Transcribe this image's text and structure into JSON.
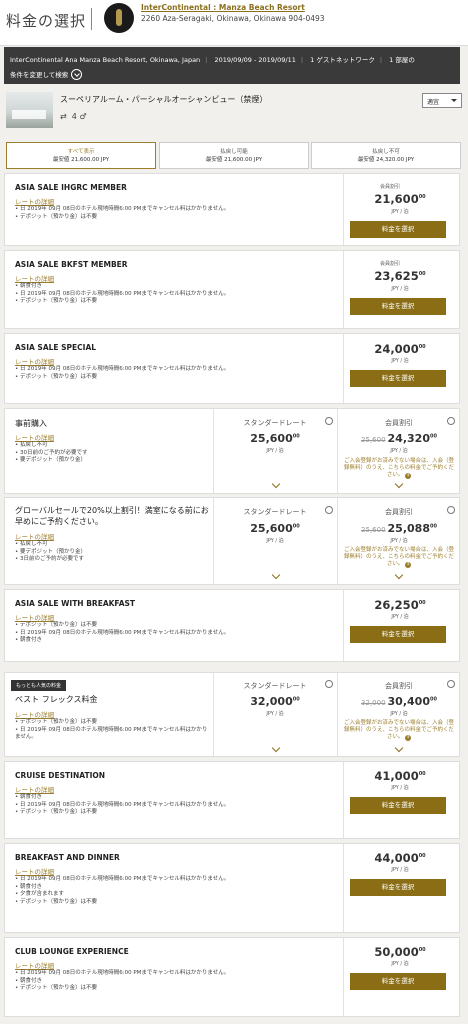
{
  "header": {
    "title": "料金の選択",
    "hotel_name": "InterContinental : Manza Beach Resort",
    "hotel_address": "2260 Aza-Seragaki, Okinawa, Okinawa 904-0493"
  },
  "search_bar": {
    "hotel": "InterContinental Ana Manza Beach Resort, Okinawa, Japan",
    "dates": "2019/09/09 - 2019/09/11",
    "guests": "1 ゲストネットワーク",
    "rooms": "1 部屋の",
    "change_label": "条件を変更して検索"
  },
  "room": {
    "name": "スーペリアルーム・パーシャルオーシャンビュー（禁煙）",
    "guests": "4",
    "sort": "適宜"
  },
  "tabs": [
    {
      "label": "すべて表示",
      "price": "最安値 21,600.00 JPY"
    },
    {
      "label": "払戻し可能",
      "price": "最安値 21,600.00 JPY"
    },
    {
      "label": "払戻し不可",
      "price": "最安値 24,320.00 JPY"
    }
  ],
  "rates": [
    {
      "name": "ASIA SALE IHGRC MEMBER",
      "link": "レートの詳細",
      "bullets": [
        "日 2019年 09月 08日のホテル現地時間6:00 PMまでキャンセル料はかかりません。",
        "デポジット（預かり金）は不要"
      ],
      "tag": "会員割引",
      "price": "21,600",
      "cents": "00",
      "unit": "JPY / 泊",
      "button": "料金を選択"
    },
    {
      "name": "ASIA SALE BKFST MEMBER",
      "link": "レートの詳細",
      "bullets": [
        "朝食付き",
        "日 2019年 09月 08日のホテル現地時間6:00 PMまでキャンセル料はかかりません。",
        "デポジット（預かり金）は不要"
      ],
      "tag": "会員割引",
      "price": "23,625",
      "cents": "00",
      "unit": "JPY / 泊",
      "button": "料金を選択"
    },
    {
      "name": "ASIA SALE SPECIAL",
      "link": "レートの詳細",
      "bullets": [
        "日 2019年 09月 08日のホテル現地時間6:00 PMまでキャンセル料はかかりません。",
        "デポジット（預かり金）は不要"
      ],
      "price": "24,000",
      "cents": "00",
      "unit": "JPY / 泊",
      "button": "料金を選択"
    },
    {
      "name": "ASIA SALE WITH BREAKFAST",
      "link": "レートの詳細",
      "bullets": [
        "デポジット（預かり金）は不要",
        "日 2019年 09月 08日のホテル現地時間6:00 PMまでキャンセル料はかかりません。",
        "朝食付き"
      ],
      "price": "26,250",
      "cents": "00",
      "unit": "JPY / 泊",
      "button": "料金を選択"
    },
    {
      "name": "CRUISE DESTINATION",
      "link": "レートの詳細",
      "bullets": [
        "朝食付き",
        "日 2019年 09月 08日のホテル現地時間6:00 PMまでキャンセル料はかかりません。",
        "デポジット（預かり金）は不要"
      ],
      "price": "41,000",
      "cents": "00",
      "unit": "JPY / 泊",
      "button": "料金を選択"
    },
    {
      "name": "BREAKFAST AND DINNER",
      "link": "レートの詳細",
      "bullets": [
        "日 2019年 09月 08日のホテル現地時間6:00 PMまでキャンセル料はかかりません。",
        "朝食付き",
        "夕食が含まれます",
        "デポジット（預かり金）は不要"
      ],
      "price": "44,000",
      "cents": "00",
      "unit": "JPY / 泊",
      "button": "料金を選択"
    },
    {
      "name": "CLUB LOUNGE EXPERIENCE",
      "link": "レートの詳細",
      "bullets": [
        "日 2019年 09月 08日のホテル現地時間6:00 PMまでキャンセル料はかかりません。",
        "朝食付き",
        "デポジット（預かり金）は不要"
      ],
      "price": "50,000",
      "cents": "00",
      "unit": "JPY / 泊",
      "button": "料金を選択"
    }
  ],
  "dual": [
    {
      "name": "事前購入",
      "link": "レートの詳細",
      "bullets": [
        "払戻し不可",
        "30日前のご予約が必要です",
        "要デポジット（預かり金）"
      ],
      "std_label": "スタンダードレート",
      "std_price": "25,600",
      "member_label": "会員割引",
      "member_old": "25,600",
      "member_price": "24,320",
      "cents": "00",
      "unit": "JPY / 泊",
      "note": "ご入会登録がお済みでない場合は、入会（登録無料）のうえ、こちらの料金でご予約ください。"
    },
    {
      "name": "グローバルセールで20%以上割引！満室になる前にお早めにご予約ください。",
      "link": "レートの詳細",
      "bullets": [
        "払戻し不可",
        "要デポジット（預かり金）",
        "3日前のご予約が必要です"
      ],
      "std_label": "スタンダードレート",
      "std_price": "25,600",
      "member_label": "会員割引",
      "member_old": "25,600",
      "member_price": "25,088",
      "cents": "00",
      "unit": "JPY / 泊",
      "note": "ご入会登録がお済みでない場合は、入会（登録無料）のうえ、こちらの料金でご予約ください。"
    },
    {
      "popular": "もっとも人気の料金",
      "name": "ベスト フレックス料金",
      "link": "レートの詳細",
      "bullets": [
        "デポジット（預かり金）は不要",
        "日 2019年 09月 08日のホテル現地時間6:00 PMまでキャンセル料はかかりません。"
      ],
      "std_label": "スタンダードレート",
      "std_price": "32,000",
      "member_label": "会員割引",
      "member_old": "32,000",
      "member_price": "30,400",
      "cents": "00",
      "unit": "JPY / 泊",
      "note": "ご入会登録がお済みでない場合は、入会（登録無料）のうえ、こちらの料金でご予約ください。"
    }
  ]
}
